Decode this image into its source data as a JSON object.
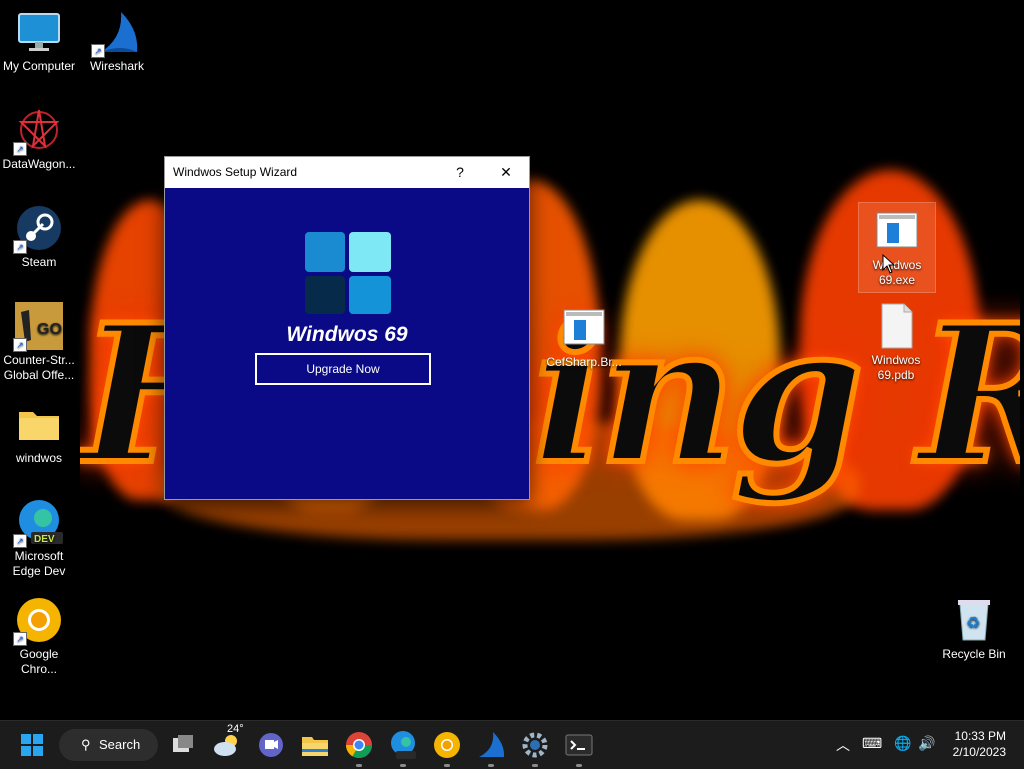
{
  "wallpaper": {
    "text": "Fuming Rage Israel"
  },
  "desktop_icons": [
    {
      "label": "My Computer",
      "icon": "monitor-icon"
    },
    {
      "label": "Wireshark",
      "icon": "wireshark-fin-icon"
    },
    {
      "label": "DataWagon...",
      "icon": "datawagon-icon"
    },
    {
      "label": "Steam",
      "icon": "steam-icon"
    },
    {
      "label": "Counter-Str... Global Offe...",
      "icon": "csgo-icon"
    },
    {
      "label": "windwos",
      "icon": "folder-icon"
    },
    {
      "label": "Microsoft Edge Dev",
      "icon": "edge-dev-icon"
    },
    {
      "label": "Google Chro...",
      "icon": "chrome-canary-icon"
    },
    {
      "label": "CefSharp.Br...",
      "icon": "application-icon"
    },
    {
      "label": "Windwos 69.exe",
      "icon": "application-icon"
    },
    {
      "label": "Windwos 69.pdb",
      "icon": "file-icon"
    },
    {
      "label": "Recycle Bin",
      "icon": "recycle-bin-icon"
    }
  ],
  "dialog": {
    "title": "Windwos Setup Wizard",
    "help_label": "?",
    "close_label": "✕",
    "product_name": "Windwos 69",
    "upgrade_label": "Upgrade Now"
  },
  "taskbar": {
    "search_label": "Search",
    "weather_temp": "24°",
    "time": "10:33 PM",
    "date": "2/10/2023",
    "apps": [
      "task-view-icon",
      "weather-icon",
      "teams-chat-icon",
      "file-explorer-icon",
      "chrome-icon",
      "edge-dev-icon",
      "chrome-canary-icon",
      "wireshark-icon",
      "settings-icon",
      "terminal-icon"
    ]
  },
  "colors": {
    "dialog_client": "#0a0a86",
    "taskbar": "#1c1c1c",
    "accent": "#0078d4"
  }
}
